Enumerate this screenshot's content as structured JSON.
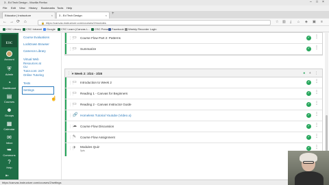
{
  "window": {
    "title": "3 - Ed Tech Design - Mozilla Firefox",
    "controls": [
      "–",
      "□",
      "×"
    ]
  },
  "menubar": [
    "File",
    "Edit",
    "View",
    "History",
    "Bookmarks",
    "Tools",
    "Help"
  ],
  "tabs": [
    {
      "label": "Educator | Instructure",
      "active": false
    },
    {
      "label": "3 - Ed Tech Design",
      "active": true
    }
  ],
  "navbar": {
    "url": "https://canvas.instructure.com/courses/2/modules",
    "back": "←",
    "forward": "→",
    "reload": "⟳",
    "home": "⌂"
  },
  "bookmarks": [
    {
      "label": "CSC Library",
      "color": "#1e6e46"
    },
    {
      "label": "CSC Intranet",
      "color": "#1e6e46"
    },
    {
      "label": "Google",
      "color": "#4285f4"
    },
    {
      "label": "CSC Learn (Canvas L...",
      "color": "#1e6e46"
    },
    {
      "label": "CSC Press",
      "color": "#1e6e46"
    },
    {
      "label": "Facebook",
      "color": "#3b5998"
    },
    {
      "label": "Weekly Recorder Login",
      "color": "#888888"
    }
  ],
  "global_nav": {
    "logo_text": "ESC",
    "items": [
      {
        "label": "Account",
        "icon": "avatar"
      },
      {
        "label": "Admin",
        "icon": "shield-icon"
      },
      {
        "label": "Dashboard",
        "icon": "dashboard-icon"
      },
      {
        "label": "Courses",
        "icon": "book-icon"
      },
      {
        "label": "Groups",
        "icon": "people-icon"
      },
      {
        "label": "Calendar",
        "icon": "calendar-icon"
      },
      {
        "label": "Inbox",
        "icon": "inbox-icon"
      },
      {
        "label": "Commons",
        "icon": "commons-icon"
      },
      {
        "label": "Help",
        "icon": "help-icon"
      }
    ]
  },
  "course_nav": {
    "links": [
      "Course Evaluations",
      "LockDown Browser",
      "Cameron Library",
      "Virtual Web Resources at CU",
      "Tutor.com: 24/7 Online Tutoring",
      "Tests",
      "Settings"
    ],
    "active": "Settings"
  },
  "modules": [
    {
      "title": "",
      "items": [
        {
          "title": "Course Flow Part 2: Patterns",
          "type": "page"
        },
        {
          "title": "Summarize",
          "type": "page"
        }
      ]
    },
    {
      "title": "Week 2: 3/24 - 3/28",
      "items": [
        {
          "title": "Introduction to Week 2",
          "type": "page",
          "sub": ""
        },
        {
          "title": "Reading 1 - Canvas for Beginners",
          "type": "page",
          "sub": ""
        },
        {
          "title": "Reading 2 - Canvas Instructor Guide",
          "type": "page",
          "sub": ""
        },
        {
          "title": "Homeless Tutorial Youtube (Video a)",
          "type": "link",
          "sub": ""
        },
        {
          "title": "Course Flow Discussion",
          "type": "discussion",
          "sub": ""
        },
        {
          "title": "Course Flow Assignment",
          "type": "assignment",
          "sub": ""
        },
        {
          "title": "Modules Quiz",
          "type": "quiz",
          "sub": "5pts"
        }
      ]
    }
  ],
  "icons": {
    "check": "✓",
    "kebab": "⋮",
    "grip": "⋮⋮",
    "collapse": "▾",
    "add": "+"
  },
  "statusbar": {
    "text": "https://canvas.instructure.com/courses/2/settings"
  },
  "colors": {
    "canvas_green": "#1e6e46",
    "link_blue": "#2b7abc",
    "published_green": "#26a65b"
  }
}
